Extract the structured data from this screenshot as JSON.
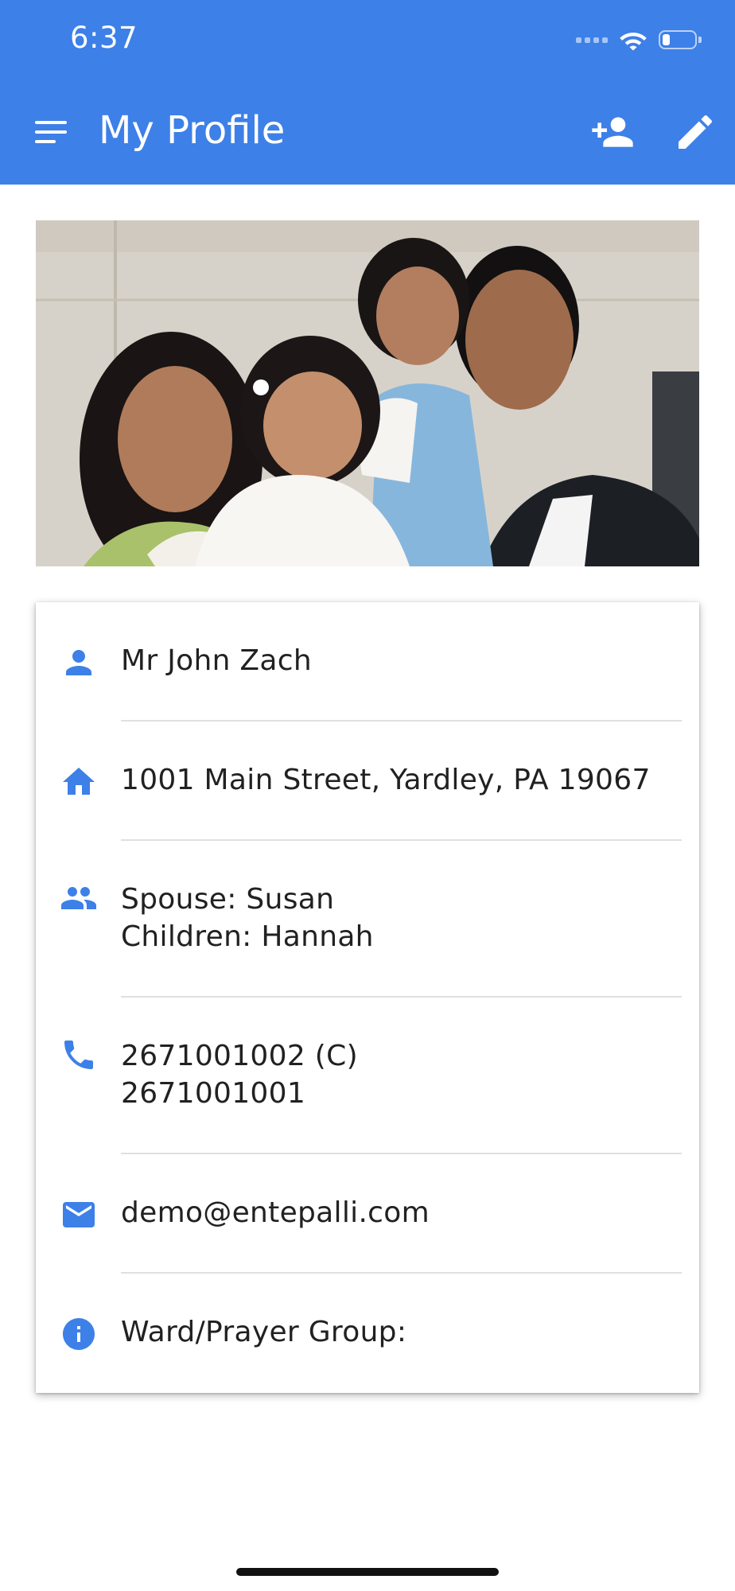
{
  "status_bar": {
    "time": "6:37",
    "battery_level": 0.25
  },
  "app_bar": {
    "title": "My Profile",
    "menu_icon": "menu-icon",
    "actions": [
      "person-add-icon",
      "edit-icon"
    ]
  },
  "profile": {
    "photo_alt": "Family photo",
    "rows": [
      {
        "icon": "person-icon",
        "line1": "Mr John Zach",
        "line2": ""
      },
      {
        "icon": "home-icon",
        "line1": "1001 Main Street, Yardley, PA 19067",
        "line2": ""
      },
      {
        "icon": "people-icon",
        "line1": "Spouse: Susan",
        "line2": "Children: Hannah"
      },
      {
        "icon": "phone-icon",
        "line1": "2671001002 (C)",
        "line2": "2671001001"
      },
      {
        "icon": "email-icon",
        "line1": "demo@entepalli.com",
        "line2": ""
      },
      {
        "icon": "info-icon",
        "line1": "Ward/Prayer Group:",
        "line2": ""
      }
    ]
  },
  "colors": {
    "primary": "#3D80E8",
    "divider": "#e0e0e0",
    "text": "#212121"
  }
}
